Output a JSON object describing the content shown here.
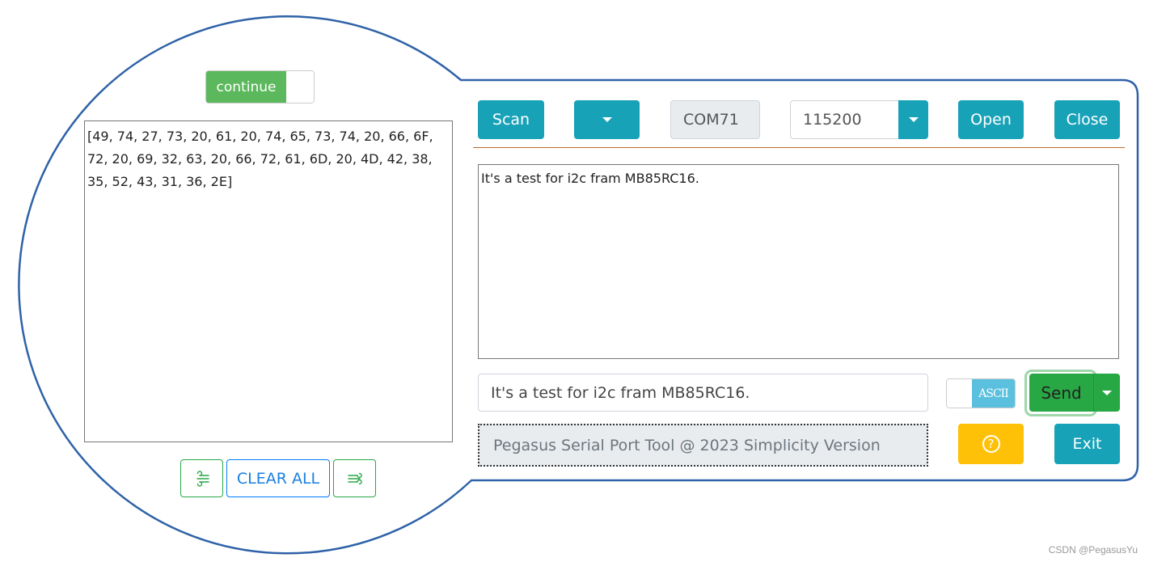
{
  "receive": {
    "continue_toggle_label": "continue",
    "continue_toggle_on": true,
    "hex_output": "[49, 74, 27, 73, 20, 61, 20, 74, 65, 73, 74, 20, 66, 6F, 72, 20, 69, 32, 63, 20, 66, 72, 61, 6D, 20, 4D, 42, 38, 35, 52, 43, 31, 36, 2E]",
    "clear_all_label": "CLEAR ALL",
    "left_icon": "wind-icon",
    "right_icon": "wind-icon"
  },
  "toolbar": {
    "scan_label": "Scan",
    "port_dropdown_icon": "caret-down-icon",
    "port_value": "COM71",
    "baud_value": "115200",
    "baud_dropdown_icon": "caret-down-icon",
    "open_label": "Open",
    "close_label": "Close"
  },
  "log": {
    "text": "It's a test for i2c fram MB85RC16."
  },
  "send": {
    "input_value": "It's a test for i2c fram MB85RC16.",
    "mode_label": "ASCII",
    "send_label": "Send",
    "send_dropdown_icon": "caret-down-icon"
  },
  "footer": {
    "status_text": "Pegasus Serial Port Tool @ 2023 Simplicity Version",
    "help_icon": "question-circle-icon",
    "exit_label": "Exit"
  },
  "watermark": "CSDN @PegasusYu",
  "colors": {
    "outline": "#2f62a8",
    "teal": "#17a2b8",
    "green": "#28a745",
    "toggle_green": "#5cb85c",
    "info": "#5bc0de",
    "warning": "#ffc107",
    "divider": "#c0692a"
  }
}
